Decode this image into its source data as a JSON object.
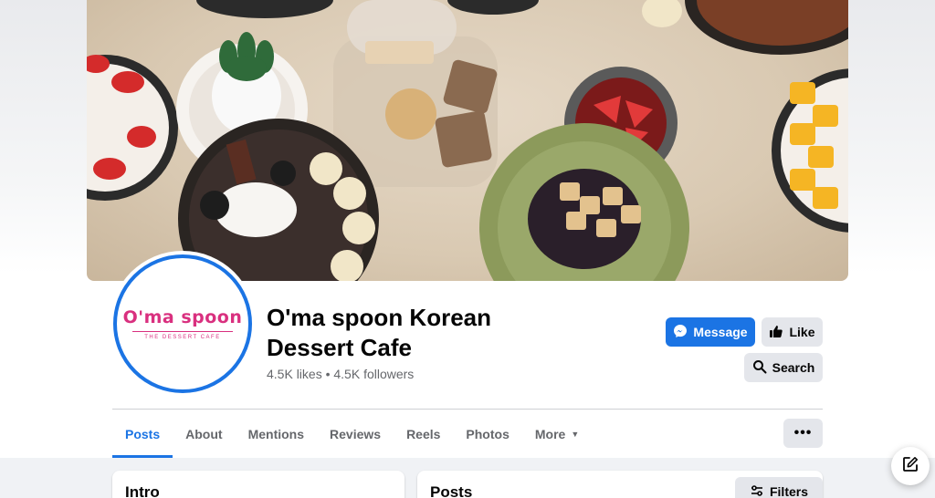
{
  "page": {
    "name": "O'ma spoon Korean Dessert Cafe",
    "stats": "4.5K likes • 4.5K followers"
  },
  "logo": {
    "main": "O'ma spoon",
    "sub": "THE DESSERT CAFE"
  },
  "actions": {
    "message_label": "Message",
    "like_label": "Like",
    "search_label": "Search",
    "more_options_label": "•••"
  },
  "tabs": [
    {
      "label": "Posts",
      "active": true
    },
    {
      "label": "About"
    },
    {
      "label": "Mentions"
    },
    {
      "label": "Reviews"
    },
    {
      "label": "Reels"
    },
    {
      "label": "Photos"
    },
    {
      "label": "More"
    }
  ],
  "sections": {
    "intro_title": "Intro",
    "posts_title": "Posts",
    "filters_label": "Filters"
  },
  "icons": {
    "message": "messenger-icon",
    "like": "thumbs-up-icon",
    "search": "search-icon",
    "filters": "filters-icon",
    "compose": "compose-icon",
    "more_caret": "caret-down-icon"
  },
  "colors": {
    "accent": "#1b74e4",
    "brand_pink": "#d9307f",
    "button_gray": "#e4e6eb",
    "text_secondary": "#65676b"
  }
}
